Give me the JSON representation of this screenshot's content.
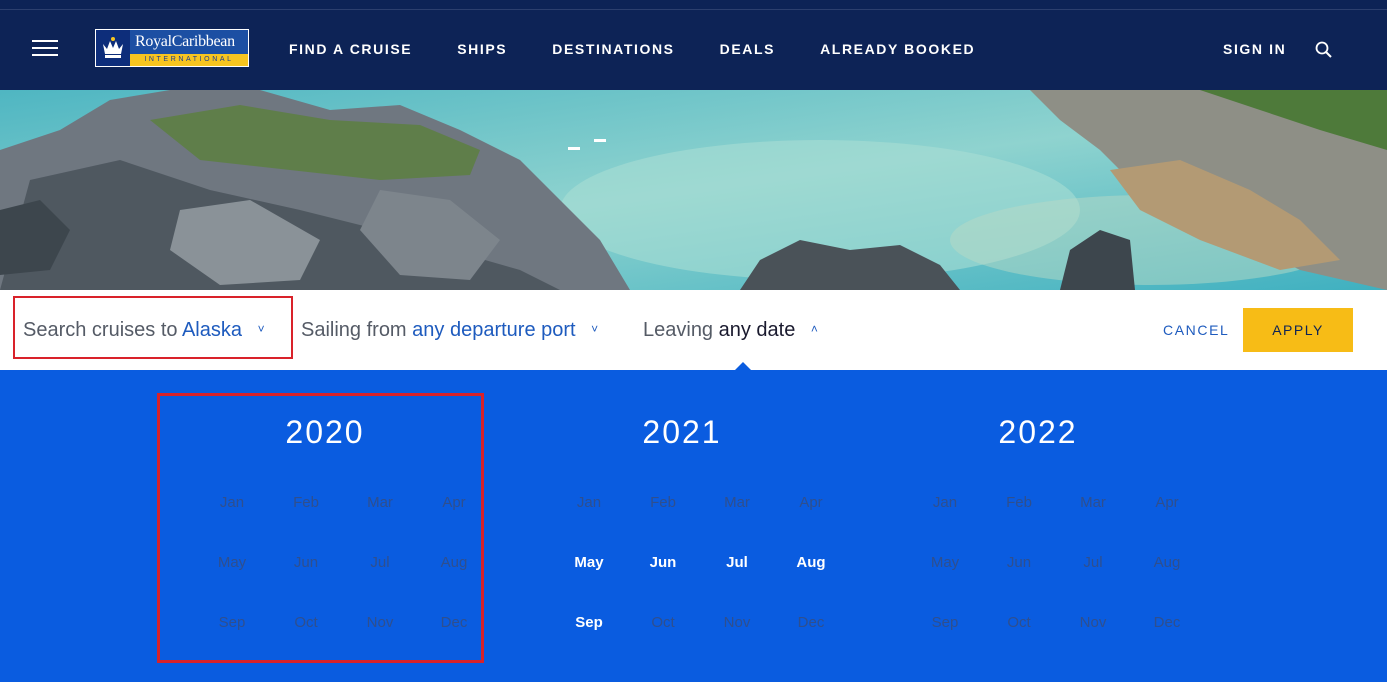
{
  "header": {
    "logo": {
      "brand": "RoyalCaribbean",
      "sub": "INTERNATIONAL"
    },
    "nav": [
      {
        "label": "FIND A CRUISE"
      },
      {
        "label": "SHIPS"
      },
      {
        "label": "DESTINATIONS"
      },
      {
        "label": "DEALS"
      },
      {
        "label": "ALREADY BOOKED"
      }
    ],
    "sign_in": "SIGN IN",
    "icons": {
      "menu": "hamburger-menu-icon",
      "search": "search-icon",
      "crown": "crown-anchor-icon"
    }
  },
  "filters": {
    "destination": {
      "prefix": "Search cruises to",
      "value": "Alaska",
      "chevron": "˅"
    },
    "port": {
      "prefix": "Sailing from",
      "value": "any departure port",
      "chevron": "˅"
    },
    "date": {
      "prefix": "Leaving",
      "value": "any date",
      "chevron": "˄"
    },
    "cancel": "CANCEL",
    "apply": "APPLY"
  },
  "calendar": {
    "years": [
      {
        "year": "2020",
        "months": [
          {
            "label": "Jan",
            "available": false
          },
          {
            "label": "Feb",
            "available": false
          },
          {
            "label": "Mar",
            "available": false
          },
          {
            "label": "Apr",
            "available": false
          },
          {
            "label": "May",
            "available": false
          },
          {
            "label": "Jun",
            "available": false
          },
          {
            "label": "Jul",
            "available": false
          },
          {
            "label": "Aug",
            "available": false
          },
          {
            "label": "Sep",
            "available": false
          },
          {
            "label": "Oct",
            "available": false
          },
          {
            "label": "Nov",
            "available": false
          },
          {
            "label": "Dec",
            "available": false
          }
        ]
      },
      {
        "year": "2021",
        "months": [
          {
            "label": "Jan",
            "available": false
          },
          {
            "label": "Feb",
            "available": false
          },
          {
            "label": "Mar",
            "available": false
          },
          {
            "label": "Apr",
            "available": false
          },
          {
            "label": "May",
            "available": true
          },
          {
            "label": "Jun",
            "available": true
          },
          {
            "label": "Jul",
            "available": true
          },
          {
            "label": "Aug",
            "available": true
          },
          {
            "label": "Sep",
            "available": true
          },
          {
            "label": "Oct",
            "available": false
          },
          {
            "label": "Nov",
            "available": false
          },
          {
            "label": "Dec",
            "available": false
          }
        ]
      },
      {
        "year": "2022",
        "months": [
          {
            "label": "Jan",
            "available": false
          },
          {
            "label": "Feb",
            "available": false
          },
          {
            "label": "Mar",
            "available": false
          },
          {
            "label": "Apr",
            "available": false
          },
          {
            "label": "May",
            "available": false
          },
          {
            "label": "Jun",
            "available": false
          },
          {
            "label": "Jul",
            "available": false
          },
          {
            "label": "Aug",
            "available": false
          },
          {
            "label": "Sep",
            "available": false
          },
          {
            "label": "Oct",
            "available": false
          },
          {
            "label": "Nov",
            "available": false
          },
          {
            "label": "Dec",
            "available": false
          }
        ]
      }
    ]
  },
  "colors": {
    "header_bg": "#0d2356",
    "calendar_bg": "#0a5ce0",
    "accent_blue": "#1e5bbe",
    "apply_yellow": "#f7bc16",
    "highlight_red": "#d9222a",
    "month_disabled": "#2f4f8e"
  }
}
